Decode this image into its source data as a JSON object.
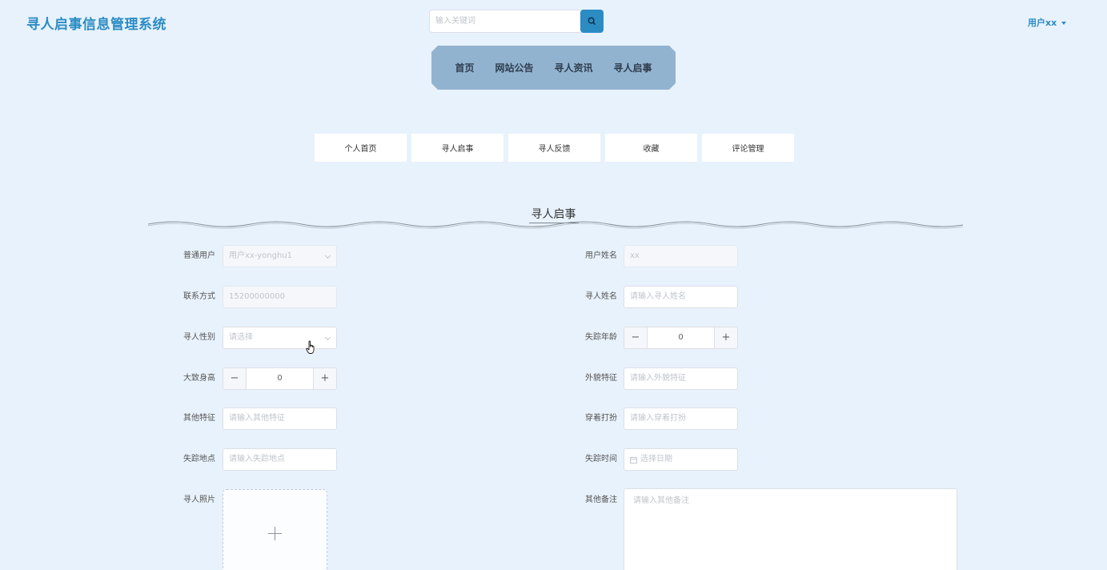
{
  "header": {
    "site_title": "寻人启事信息管理系统",
    "search_placeholder": "输入关键词",
    "user_label": "用户xx"
  },
  "main_nav": [
    "首页",
    "网站公告",
    "寻人资讯",
    "寻人启事"
  ],
  "sub_tabs": [
    "个人首页",
    "寻人启事",
    "寻人反馈",
    "收藏",
    "评论管理"
  ],
  "section_title": "寻人启事",
  "form": {
    "user": {
      "label": "普通用户",
      "value": "用户xx-yonghu1"
    },
    "user_name": {
      "label": "用户姓名",
      "value": "xx"
    },
    "contact": {
      "label": "联系方式",
      "value": "15200000000"
    },
    "person_name": {
      "label": "寻人姓名",
      "placeholder": "请输入寻人姓名"
    },
    "gender": {
      "label": "寻人性别",
      "placeholder": "请选择"
    },
    "age": {
      "label": "失踪年龄",
      "value": "0",
      "minus": "−",
      "plus": "+"
    },
    "height": {
      "label": "大致身高",
      "value": "0",
      "minus": "−",
      "plus": "+"
    },
    "appearance": {
      "label": "外貌特征",
      "placeholder": "请输入外貌特征"
    },
    "other_features": {
      "label": "其他特征",
      "placeholder": "请输入其他特征"
    },
    "clothing": {
      "label": "穿着打扮",
      "placeholder": "请输入穿着打扮"
    },
    "location": {
      "label": "失踪地点",
      "placeholder": "请输入失踪地点"
    },
    "time": {
      "label": "失踪时间",
      "placeholder": "选择日期"
    },
    "photo": {
      "label": "寻人照片"
    },
    "remarks": {
      "label": "其他备注",
      "placeholder": "请输入其他备注"
    }
  },
  "colors": {
    "accent": "#2b8cc4",
    "background": "#e8f2fc",
    "nav_bg": "#92b3d0"
  }
}
